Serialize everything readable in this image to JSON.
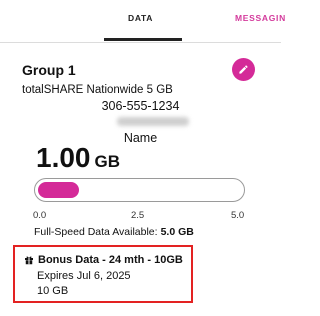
{
  "tabs": {
    "data": "DATA",
    "messaging": "MESSAGIN"
  },
  "group": {
    "title": "Group 1",
    "plan": "totalSHARE Nationwide 5 GB",
    "phone": "306-555-1234",
    "member_name": "Name"
  },
  "usage": {
    "value": "1.00",
    "unit": "GB",
    "used_fraction": 0.2,
    "scale": {
      "min": "0.0",
      "mid": "2.5",
      "max": "5.0"
    },
    "available_label": "Full-Speed Data Available:",
    "available_value": "5.0 GB"
  },
  "bonus": {
    "title": "Bonus Data - 24 mth - 10GB",
    "expires": "Expires Jul 6, 2025",
    "amount": "10 GB"
  },
  "colors": {
    "accent": "#d42a98",
    "highlight_border": "#e32222"
  },
  "icons": {
    "edit": "pencil-icon",
    "bonus": "gift-icon"
  }
}
